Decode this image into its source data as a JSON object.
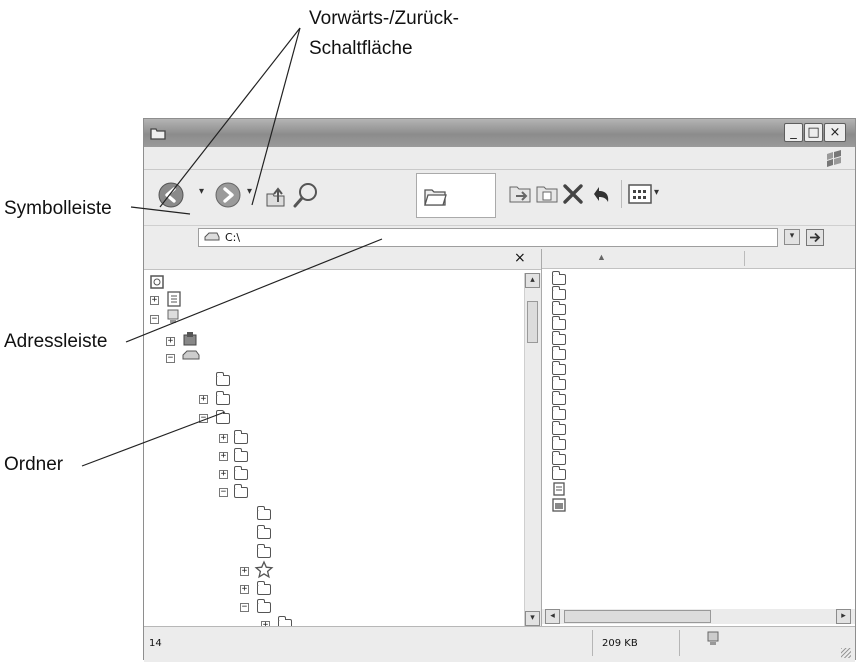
{
  "callouts": {
    "nav_buttons_line1": "Vorwärts-/Zurück-",
    "nav_buttons_line2": "Schaltfläche",
    "toolbar": "Symbolleiste",
    "address_bar": "Adressleiste",
    "folders": "Ordner"
  },
  "window": {
    "controls": {
      "minimize": "_",
      "maximize": "□",
      "close": "×"
    }
  },
  "address": {
    "value": "C:\\"
  },
  "left_pane": {
    "close_glyph": "×"
  },
  "status": {
    "count": "14",
    "size": "209 KB"
  },
  "icons": [
    "back-arrow-icon",
    "forward-arrow-icon",
    "up-folder-icon",
    "search-icon",
    "folders-icon",
    "move-to-icon",
    "copy-to-icon",
    "delete-icon",
    "undo-icon",
    "views-icon",
    "go-arrow-icon",
    "windows-flag-icon",
    "drive-icon",
    "folder-icon",
    "favorites-star-icon"
  ],
  "colors": {
    "window_bg": "#d4d4d4",
    "titlebar": "#9a9a9a",
    "pane_bg": "#ffffff"
  }
}
